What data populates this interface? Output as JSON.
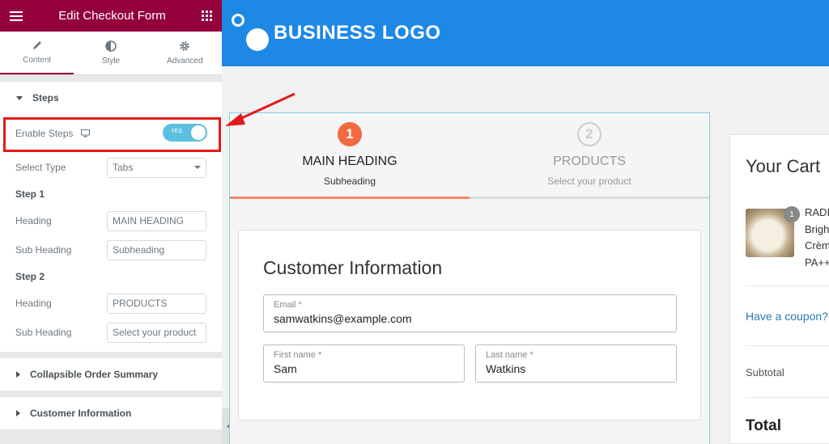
{
  "sidebar": {
    "title": "Edit Checkout Form",
    "tabs": [
      {
        "label": "Content",
        "icon": "pencil-icon"
      },
      {
        "label": "Style",
        "icon": "contrast-icon"
      },
      {
        "label": "Advanced",
        "icon": "gear-icon"
      }
    ],
    "active_tab": "Content",
    "steps_section": {
      "title": "Steps",
      "enable_steps_label": "Enable Steps",
      "enable_steps_toggle": "YES",
      "enable_steps_on": true,
      "select_type_label": "Select Type",
      "select_type_value": "Tabs",
      "step1": {
        "title": "Step 1",
        "heading_label": "Heading",
        "heading_value": "MAIN HEADING",
        "subheading_label": "Sub Heading",
        "subheading_value": "Subheading"
      },
      "step2": {
        "title": "Step 2",
        "heading_label": "Heading",
        "heading_value": "PRODUCTS",
        "subheading_label": "Sub Heading",
        "subheading_value": "Select your product"
      }
    },
    "collapsed_sections": [
      "Collapsible Order Summary",
      "Customer Information"
    ]
  },
  "preview": {
    "logo_text": "BUSINESS LOGO",
    "steps": [
      {
        "number": "1",
        "heading": "MAIN HEADING",
        "subheading": "Subheading",
        "active": true
      },
      {
        "number": "2",
        "heading": "PRODUCTS",
        "subheading": "Select your product",
        "active": false
      }
    ],
    "customer_info": {
      "title": "Customer Information",
      "email_label": "Email *",
      "email_value": "samwatkins@example.com",
      "first_name_label": "First name *",
      "first_name_value": "Sam",
      "last_name_label": "Last name *",
      "last_name_value": "Watkins"
    },
    "cart": {
      "title": "Your Cart",
      "item_qty": "1",
      "item_lines": [
        "RADI",
        "Brigh",
        "Crèm",
        "PA++"
      ],
      "coupon_link": "Have a coupon?",
      "subtotal_label": "Subtotal",
      "total_label": "Total"
    }
  },
  "colors": {
    "header": "#93003c",
    "topbar": "#1e88e5",
    "accent_step": "#f06a42",
    "toggle": "#5bc0de",
    "highlight": "#e01a1a"
  }
}
